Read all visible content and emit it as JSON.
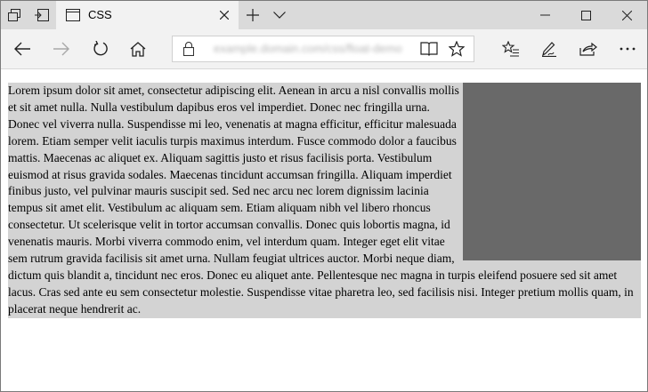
{
  "tab": {
    "title": "CSS"
  },
  "toolbar": {
    "url": "example.domain.com/css/float-demo"
  },
  "page": {
    "paragraph": "Lorem ipsum dolor sit amet, consectetur adipiscing elit. Aenean in arcu a nisl convallis mollis et sit amet nulla. Nulla vestibulum dapibus eros vel imperdiet. Donec nec fringilla urna. Donec vel viverra nulla. Suspendisse mi leo, venenatis at magna efficitur, efficitur malesuada lorem. Etiam semper velit iaculis turpis maximus interdum. Fusce commodo dolor a faucibus mattis. Maecenas ac aliquet ex. Aliquam sagittis justo et risus facilisis porta. Vestibulum euismod at risus gravida sodales. Maecenas tincidunt accumsan fringilla. Aliquam imperdiet finibus justo, vel pulvinar mauris suscipit sed. Sed nec arcu nec lorem dignissim lacinia tempus sit amet elit. Vestibulum ac aliquam sem. Etiam aliquam nibh vel libero rhoncus consectetur. Ut scelerisque velit in tortor accumsan convallis. Donec quis lobortis magna, id venenatis mauris. Morbi viverra commodo enim, vel interdum quam. Integer eget elit vitae sem rutrum gravida facilisis sit amet urna. Nullam feugiat ultrices auctor. Morbi neque diam, dictum quis blandit a, tincidunt nec eros. Donec eu aliquet ante. Pellentesque nec magna in turpis eleifend posuere sed sit amet lacus. Cras sed ante eu sem consectetur molestie. Suspendisse vitae pharetra leo, sed facilisis nisi. Integer pretium mollis quam, in placerat neque hendrerit ac."
  },
  "colors": {
    "text_background": "#d3d3d3",
    "float_box": "#696969",
    "titlebar": "#dadada",
    "toolbar": "#f2f2f2"
  }
}
